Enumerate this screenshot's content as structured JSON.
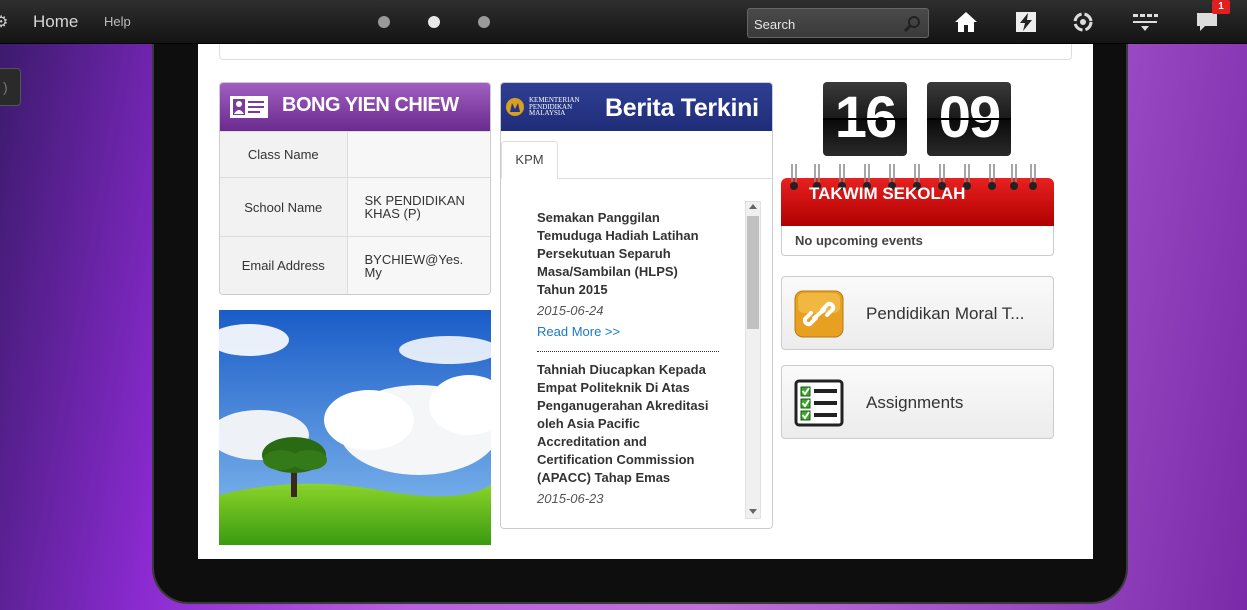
{
  "topbar": {
    "home_label": "Home",
    "help_label": "Help",
    "search": {
      "placeholder": "Search"
    },
    "notification_count": "1"
  },
  "profile": {
    "name": "BONG YIEN CHIEW",
    "rows": [
      {
        "label": "Class Name",
        "value": ""
      },
      {
        "label": "School Name",
        "value": "SK PENDIDIKAN KHAS (P)"
      },
      {
        "label": "Email Address",
        "value": "BYCHIEW@Yes.My"
      }
    ]
  },
  "news": {
    "logo_text": [
      "KEMENTERIAN",
      "PENDIDIKAN",
      "MALAYSIA"
    ],
    "title": "Berita Terkini",
    "tabs": [
      {
        "label": "KPM"
      }
    ],
    "items": [
      {
        "title": "Semakan Panggilan Temuduga Hadiah Latihan Persekutuan Separuh Masa/Sambilan (HLPS) Tahun 2015",
        "date": "2015-06-24",
        "more": "Read More >>"
      },
      {
        "title": "Tahniah Diucapkan Kepada Empat Politeknik Di Atas Penganugerahan Akreditasi oleh Asia Pacific Accreditation and Certification Commission (APACC) Tahap Emas",
        "date": "2015-06-23"
      }
    ]
  },
  "clock": {
    "hours": "16",
    "minutes": "09"
  },
  "takwim": {
    "title": "TAKWIM SEKOLAH",
    "empty_text": "No upcoming events"
  },
  "tiles": [
    {
      "label": "Pendidikan Moral T...",
      "icon": "link-icon"
    },
    {
      "label": "Assignments",
      "icon": "checklist-icon"
    }
  ],
  "colors": {
    "profile_header": "#7a3a9e",
    "news_header": "#263588",
    "takwim_header": "#cc1010",
    "link_blue": "#1a7ac8",
    "badge_red": "#e02020"
  }
}
